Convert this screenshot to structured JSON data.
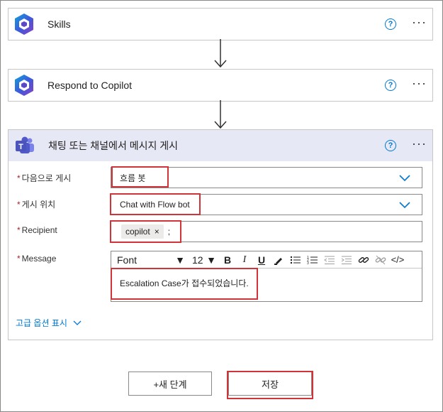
{
  "steps": [
    {
      "title": "Skills"
    },
    {
      "title": "Respond to Copilot"
    }
  ],
  "teams_step": {
    "title": "채팅 또는 채널에서 메시지 게시",
    "fields": {
      "post_as": {
        "label": "다음으로 게시",
        "value": "흐름 봇"
      },
      "post_in": {
        "label": "게시 위치",
        "value": "Chat with Flow bot"
      },
      "recipient": {
        "label": "Recipient",
        "chip": "copilot",
        "separator": ";"
      },
      "message": {
        "label": "Message",
        "font": "Font",
        "size": "12",
        "text": "Escalation Case가 접수되었습니다."
      }
    },
    "advanced_options": "고급 옵션 표시"
  },
  "common": {
    "help": "?",
    "more": "···",
    "required": "*",
    "chip_remove": "×"
  },
  "toolbar": {
    "bold": "B",
    "italic": "I",
    "underline": "U",
    "code": "</>"
  },
  "buttons": {
    "new_step": "+새 단계",
    "save": "저장"
  },
  "colors": {
    "accent": "#0078d4",
    "highlight_border": "#d13438",
    "teams_header": "#e6e8f5"
  }
}
